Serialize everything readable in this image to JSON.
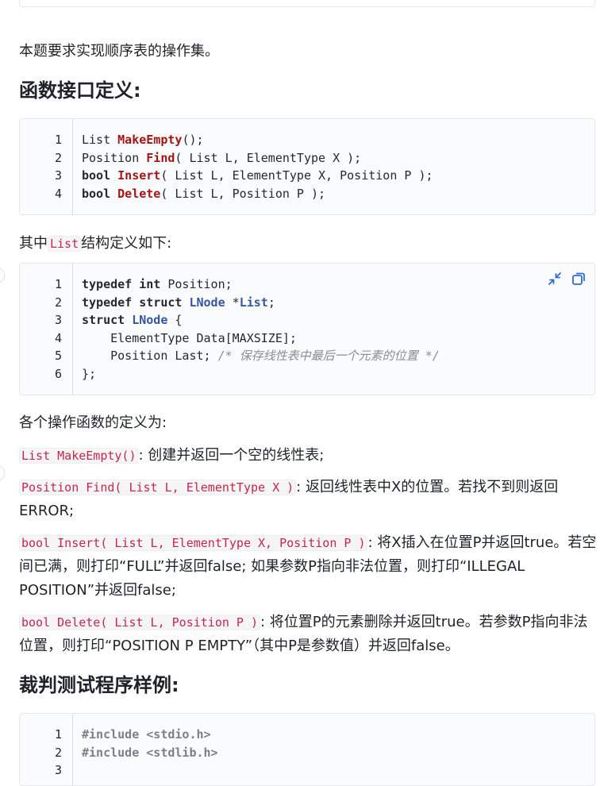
{
  "intro": "本题要求实现顺序表的操作集。",
  "heading_interface": "函数接口定义:",
  "interface_lines": [
    {
      "n": "1",
      "parts": [
        {
          "t": "List ",
          "c": ""
        },
        {
          "t": "MakeEmpty",
          "c": "fn"
        },
        {
          "t": "();",
          "c": ""
        }
      ]
    },
    {
      "n": "2",
      "parts": [
        {
          "t": "Position ",
          "c": ""
        },
        {
          "t": "Find",
          "c": "fn"
        },
        {
          "t": "( List L, ElementType X );",
          "c": ""
        }
      ]
    },
    {
      "n": "3",
      "parts": [
        {
          "t": "bool ",
          "c": "kw"
        },
        {
          "t": "Insert",
          "c": "fn"
        },
        {
          "t": "( List L, ElementType X, Position P );",
          "c": ""
        }
      ]
    },
    {
      "n": "4",
      "parts": [
        {
          "t": "bool ",
          "c": "kw"
        },
        {
          "t": "Delete",
          "c": "fn"
        },
        {
          "t": "( List L, Position P );",
          "c": ""
        }
      ]
    }
  ],
  "struct_intro": {
    "before": "其中",
    "code": "List",
    "after": "结构定义如下:"
  },
  "struct_lines": [
    {
      "n": "1",
      "parts": [
        {
          "t": "typedef ",
          "c": "kw"
        },
        {
          "t": "int ",
          "c": "kw"
        },
        {
          "t": "Position;",
          "c": ""
        }
      ]
    },
    {
      "n": "2",
      "parts": [
        {
          "t": "typedef ",
          "c": "kw"
        },
        {
          "t": "struct ",
          "c": "kw"
        },
        {
          "t": "LNode ",
          "c": "ty"
        },
        {
          "t": "*",
          "c": ""
        },
        {
          "t": "List",
          "c": "ty"
        },
        {
          "t": ";",
          "c": ""
        }
      ]
    },
    {
      "n": "3",
      "parts": [
        {
          "t": "struct ",
          "c": "kw"
        },
        {
          "t": "LNode ",
          "c": "ty"
        },
        {
          "t": "{",
          "c": ""
        }
      ]
    },
    {
      "n": "4",
      "parts": [
        {
          "t": "    ElementType Data[MAXSIZE];",
          "c": ""
        }
      ]
    },
    {
      "n": "5",
      "parts": [
        {
          "t": "    Position Last; ",
          "c": ""
        },
        {
          "t": "/* 保存线性表中最后一个元素的位置 */",
          "c": "cm"
        }
      ]
    },
    {
      "n": "6",
      "parts": [
        {
          "t": "};",
          "c": ""
        }
      ]
    }
  ],
  "ops_intro": "各个操作函数的定义为:",
  "ops": [
    {
      "code": "List MakeEmpty()",
      "text": ": 创建并返回一个空的线性表;"
    },
    {
      "code": "Position Find( List L, ElementType X )",
      "text": ": 返回线性表中X的位置。若找不到则返回ERROR;"
    },
    {
      "code": "bool Insert( List L, ElementType X, Position P )",
      "text": ": 将X插入在位置P并返回true。若空间已满，则打印“FULL”并返回false; 如果参数P指向非法位置，则打印“ILLEGAL POSITION”并返回false;"
    },
    {
      "code": "bool Delete( List L, Position P )",
      "text": ": 将位置P的元素删除并返回true。若参数P指向非法位置，则打印“POSITION P EMPTY”（其中P是参数值）并返回false。"
    }
  ],
  "heading_test": "裁判测试程序样例:",
  "test_lines": [
    {
      "n": "1",
      "parts": [
        {
          "t": "#include <stdio.h>",
          "c": "pp"
        }
      ]
    },
    {
      "n": "2",
      "parts": [
        {
          "t": "#include <stdlib.h>",
          "c": "pp"
        }
      ]
    },
    {
      "n": "3",
      "parts": [
        {
          "t": "",
          "c": ""
        }
      ]
    }
  ],
  "colors": {
    "code_fn": "#a31515",
    "code_type": "#3656a3",
    "inline_code": "#c7254e",
    "icon_blue": "#2f6bd9"
  },
  "icons": {
    "collapse": "collapse-arrows-icon",
    "copy": "copy-icon"
  }
}
